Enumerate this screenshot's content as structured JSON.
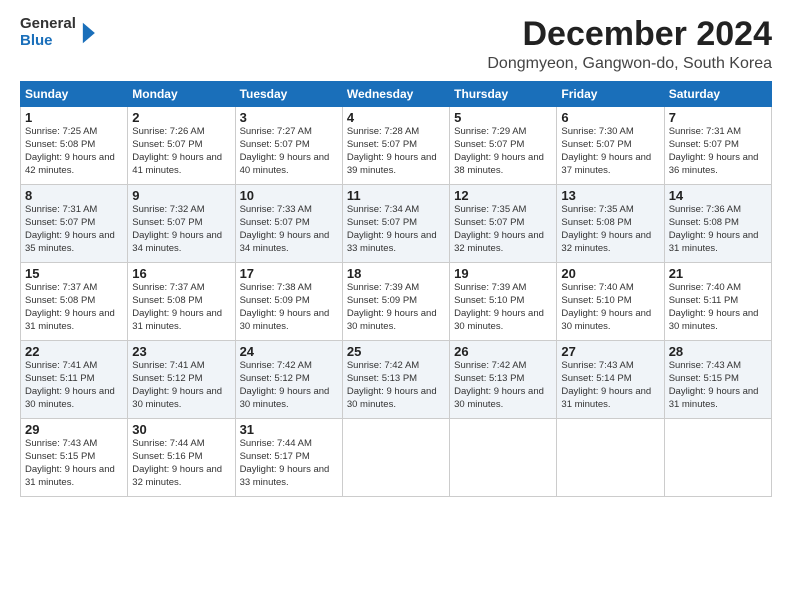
{
  "logo": {
    "general": "General",
    "blue": "Blue"
  },
  "header": {
    "month": "December 2024",
    "location": "Dongmyeon, Gangwon-do, South Korea"
  },
  "weekdays": [
    "Sunday",
    "Monday",
    "Tuesday",
    "Wednesday",
    "Thursday",
    "Friday",
    "Saturday"
  ],
  "weeks": [
    [
      {
        "day": "1",
        "sunrise": "7:25 AM",
        "sunset": "5:08 PM",
        "daylight": "9 hours and 42 minutes."
      },
      {
        "day": "2",
        "sunrise": "7:26 AM",
        "sunset": "5:07 PM",
        "daylight": "9 hours and 41 minutes."
      },
      {
        "day": "3",
        "sunrise": "7:27 AM",
        "sunset": "5:07 PM",
        "daylight": "9 hours and 40 minutes."
      },
      {
        "day": "4",
        "sunrise": "7:28 AM",
        "sunset": "5:07 PM",
        "daylight": "9 hours and 39 minutes."
      },
      {
        "day": "5",
        "sunrise": "7:29 AM",
        "sunset": "5:07 PM",
        "daylight": "9 hours and 38 minutes."
      },
      {
        "day": "6",
        "sunrise": "7:30 AM",
        "sunset": "5:07 PM",
        "daylight": "9 hours and 37 minutes."
      },
      {
        "day": "7",
        "sunrise": "7:31 AM",
        "sunset": "5:07 PM",
        "daylight": "9 hours and 36 minutes."
      }
    ],
    [
      {
        "day": "8",
        "sunrise": "7:31 AM",
        "sunset": "5:07 PM",
        "daylight": "9 hours and 35 minutes."
      },
      {
        "day": "9",
        "sunrise": "7:32 AM",
        "sunset": "5:07 PM",
        "daylight": "9 hours and 34 minutes."
      },
      {
        "day": "10",
        "sunrise": "7:33 AM",
        "sunset": "5:07 PM",
        "daylight": "9 hours and 34 minutes."
      },
      {
        "day": "11",
        "sunrise": "7:34 AM",
        "sunset": "5:07 PM",
        "daylight": "9 hours and 33 minutes."
      },
      {
        "day": "12",
        "sunrise": "7:35 AM",
        "sunset": "5:07 PM",
        "daylight": "9 hours and 32 minutes."
      },
      {
        "day": "13",
        "sunrise": "7:35 AM",
        "sunset": "5:08 PM",
        "daylight": "9 hours and 32 minutes."
      },
      {
        "day": "14",
        "sunrise": "7:36 AM",
        "sunset": "5:08 PM",
        "daylight": "9 hours and 31 minutes."
      }
    ],
    [
      {
        "day": "15",
        "sunrise": "7:37 AM",
        "sunset": "5:08 PM",
        "daylight": "9 hours and 31 minutes."
      },
      {
        "day": "16",
        "sunrise": "7:37 AM",
        "sunset": "5:08 PM",
        "daylight": "9 hours and 31 minutes."
      },
      {
        "day": "17",
        "sunrise": "7:38 AM",
        "sunset": "5:09 PM",
        "daylight": "9 hours and 30 minutes."
      },
      {
        "day": "18",
        "sunrise": "7:39 AM",
        "sunset": "5:09 PM",
        "daylight": "9 hours and 30 minutes."
      },
      {
        "day": "19",
        "sunrise": "7:39 AM",
        "sunset": "5:10 PM",
        "daylight": "9 hours and 30 minutes."
      },
      {
        "day": "20",
        "sunrise": "7:40 AM",
        "sunset": "5:10 PM",
        "daylight": "9 hours and 30 minutes."
      },
      {
        "day": "21",
        "sunrise": "7:40 AM",
        "sunset": "5:11 PM",
        "daylight": "9 hours and 30 minutes."
      }
    ],
    [
      {
        "day": "22",
        "sunrise": "7:41 AM",
        "sunset": "5:11 PM",
        "daylight": "9 hours and 30 minutes."
      },
      {
        "day": "23",
        "sunrise": "7:41 AM",
        "sunset": "5:12 PM",
        "daylight": "9 hours and 30 minutes."
      },
      {
        "day": "24",
        "sunrise": "7:42 AM",
        "sunset": "5:12 PM",
        "daylight": "9 hours and 30 minutes."
      },
      {
        "day": "25",
        "sunrise": "7:42 AM",
        "sunset": "5:13 PM",
        "daylight": "9 hours and 30 minutes."
      },
      {
        "day": "26",
        "sunrise": "7:42 AM",
        "sunset": "5:13 PM",
        "daylight": "9 hours and 30 minutes."
      },
      {
        "day": "27",
        "sunrise": "7:43 AM",
        "sunset": "5:14 PM",
        "daylight": "9 hours and 31 minutes."
      },
      {
        "day": "28",
        "sunrise": "7:43 AM",
        "sunset": "5:15 PM",
        "daylight": "9 hours and 31 minutes."
      }
    ],
    [
      {
        "day": "29",
        "sunrise": "7:43 AM",
        "sunset": "5:15 PM",
        "daylight": "9 hours and 31 minutes."
      },
      {
        "day": "30",
        "sunrise": "7:44 AM",
        "sunset": "5:16 PM",
        "daylight": "9 hours and 32 minutes."
      },
      {
        "day": "31",
        "sunrise": "7:44 AM",
        "sunset": "5:17 PM",
        "daylight": "9 hours and 33 minutes."
      },
      null,
      null,
      null,
      null
    ]
  ]
}
